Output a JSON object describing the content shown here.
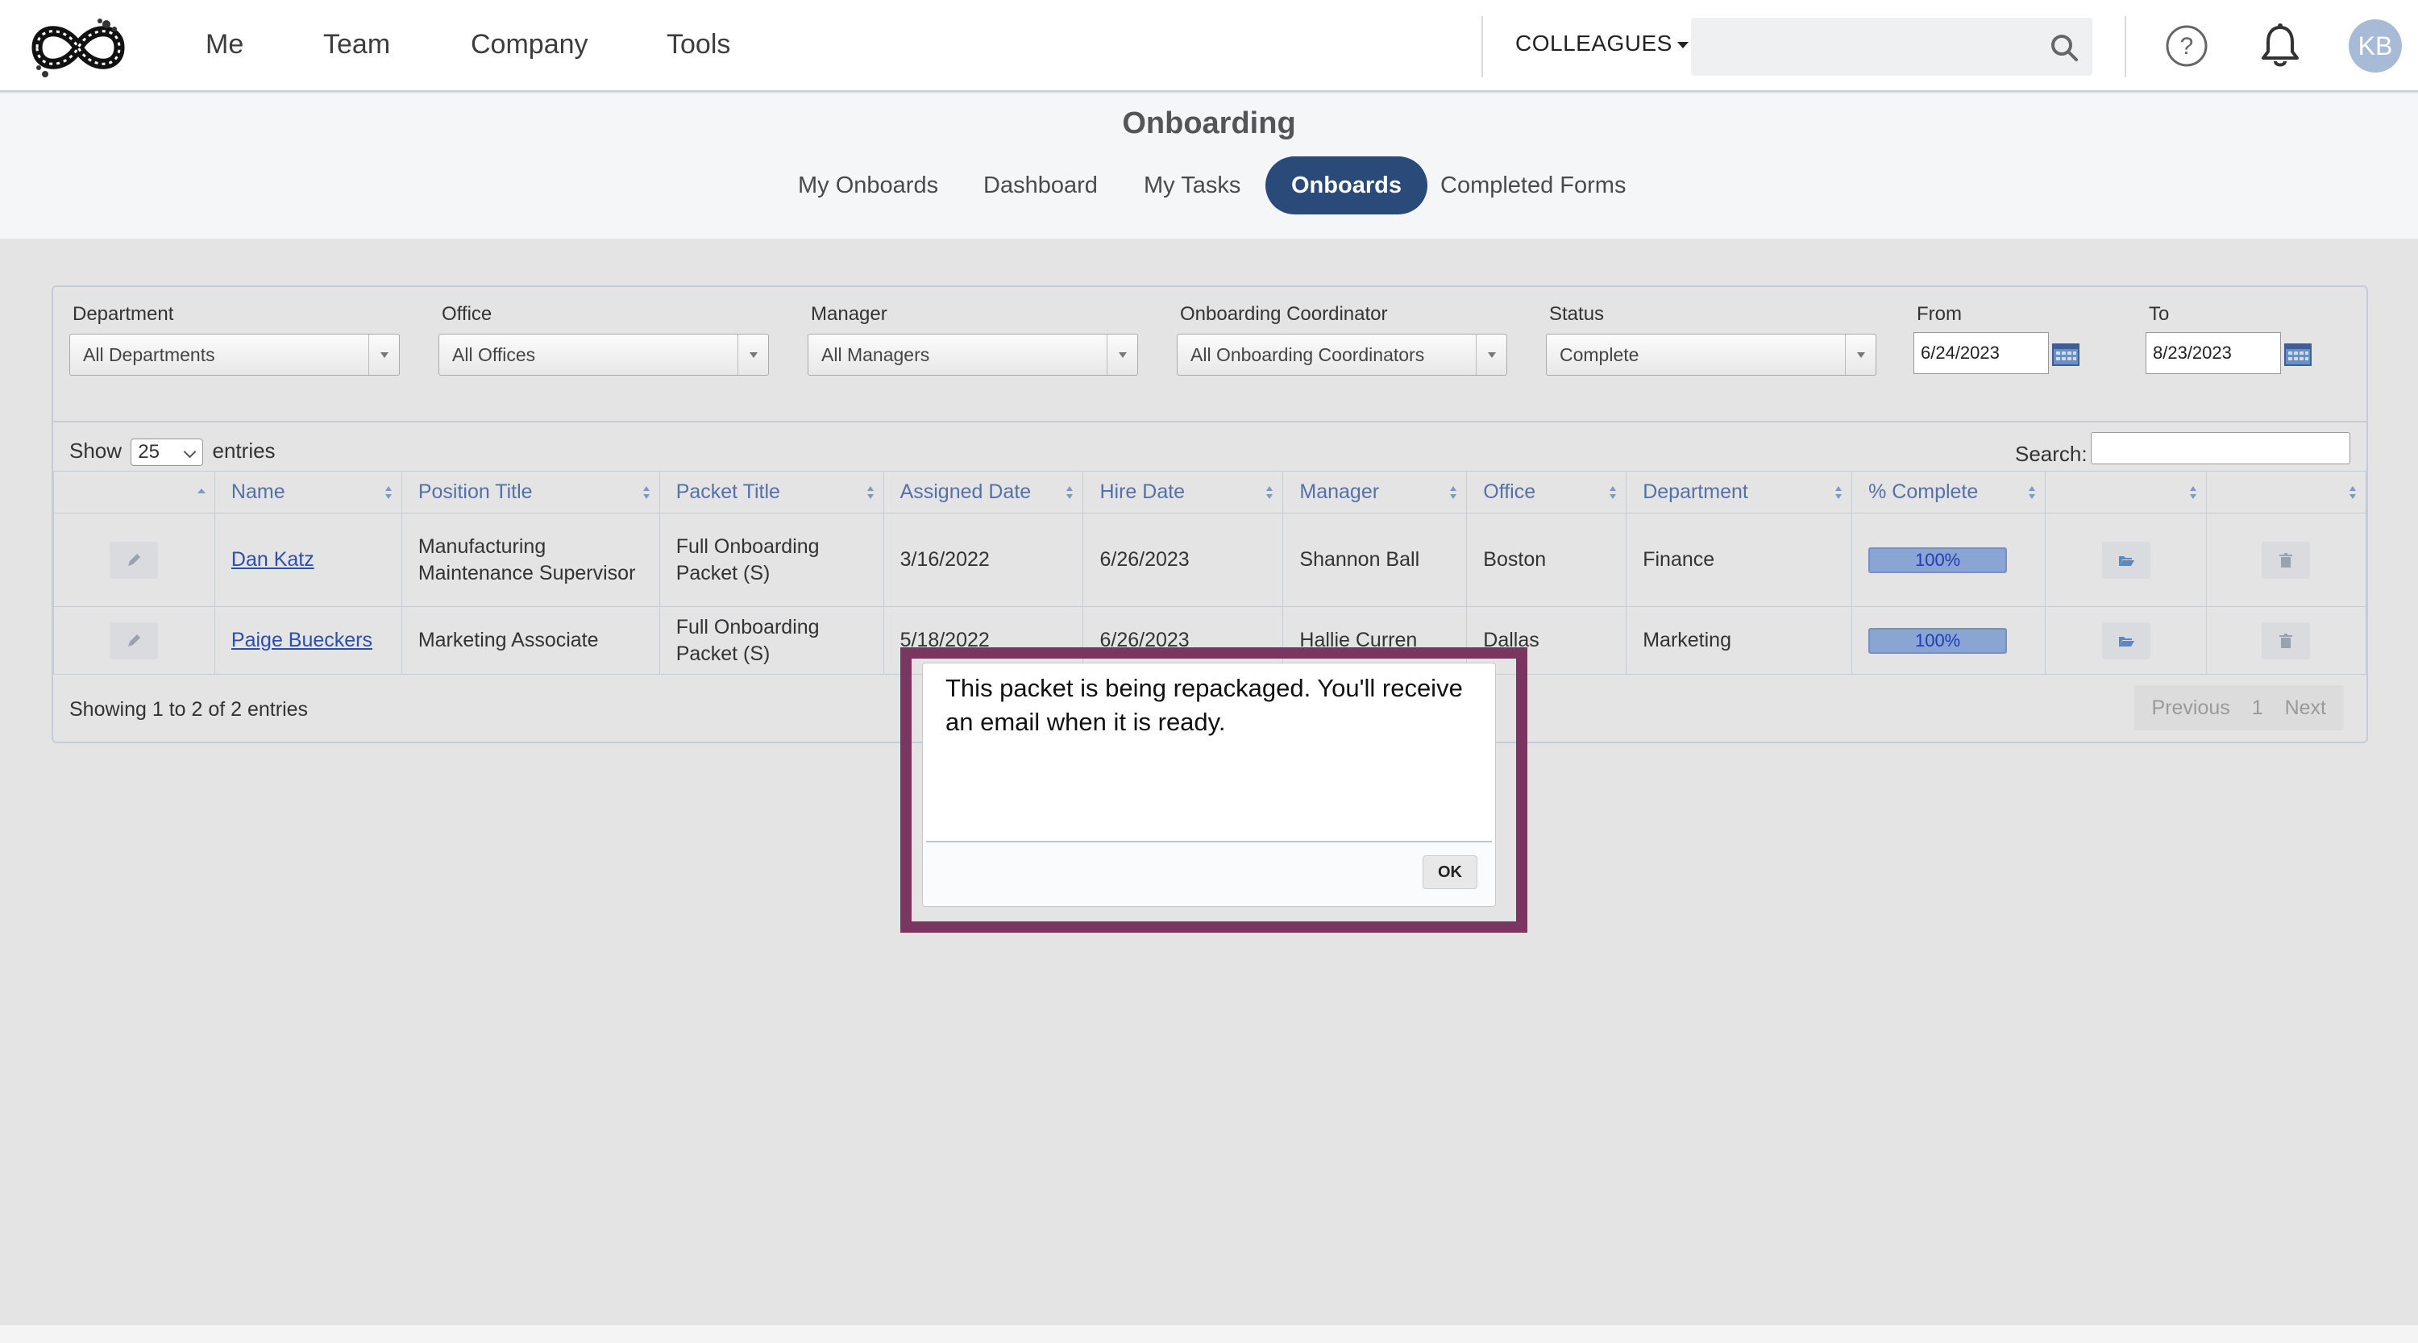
{
  "nav": {
    "links": [
      "Me",
      "Team",
      "Company",
      "Tools"
    ],
    "colleagues_label": "COLLEAGUES",
    "search_placeholder": "",
    "avatar_initials": "KB"
  },
  "header": {
    "title": "Onboarding",
    "tabs": [
      "My Onboards",
      "Dashboard",
      "My Tasks",
      "Onboards",
      "Completed Forms"
    ],
    "active_tab": "Onboards"
  },
  "filters": {
    "department": {
      "label": "Department",
      "value": "All Departments"
    },
    "office": {
      "label": "Office",
      "value": "All Offices"
    },
    "manager": {
      "label": "Manager",
      "value": "All Managers"
    },
    "coordinator": {
      "label": "Onboarding Coordinator",
      "value": "All Onboarding Coordinators"
    },
    "status": {
      "label": "Status",
      "value": "Complete"
    },
    "from": {
      "label": "From",
      "value": "6/24/2023"
    },
    "to": {
      "label": "To",
      "value": "8/23/2023"
    }
  },
  "table": {
    "show_label": "Show",
    "entries_value": "25",
    "entries_label": "entries",
    "search_label": "Search:",
    "headers": [
      "",
      "Name",
      "Position Title",
      "Packet Title",
      "Assigned Date",
      "Hire Date",
      "Manager",
      "Office",
      "Department",
      "% Complete",
      "",
      ""
    ],
    "rows": [
      {
        "name": "Dan Katz",
        "position": "Manufacturing Maintenance Supervisor",
        "packet": "Full Onboarding Packet (S)",
        "assigned": "3/16/2022",
        "hire": "6/26/2023",
        "manager": "Shannon Ball",
        "office": "Boston",
        "department": "Finance",
        "complete": "100%"
      },
      {
        "name": "Paige Bueckers",
        "position": "Marketing Associate",
        "packet": "Full Onboarding Packet (S)",
        "assigned": "5/18/2022",
        "hire": "6/26/2023",
        "manager": "Hallie Curren",
        "office": "Dallas",
        "department": "Marketing",
        "complete": "100%"
      }
    ],
    "showing": "Showing 1 to 2 of 2 entries",
    "pager": {
      "previous": "Previous",
      "page": "1",
      "next": "Next"
    }
  },
  "dialog": {
    "message": "This packet is being repackaged. You'll receive an email when it is ready.",
    "ok_label": "OK"
  },
  "colors": {
    "accent": "#2a4a7a",
    "dialog_highlight": "#7a3560",
    "progress": "#8aa4d4",
    "link": "#2b4fb0"
  }
}
